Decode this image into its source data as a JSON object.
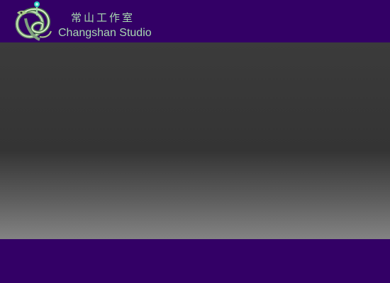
{
  "header": {
    "logo_icon": "dragon-emblem-icon",
    "title_cn": "常山工作室",
    "title_en": "Changshan Studio"
  },
  "colors": {
    "brand_bg": "#330066",
    "title_text": "#a8d9b0",
    "stage_top": "#3b3b3b",
    "stage_bottom": "#838383"
  }
}
